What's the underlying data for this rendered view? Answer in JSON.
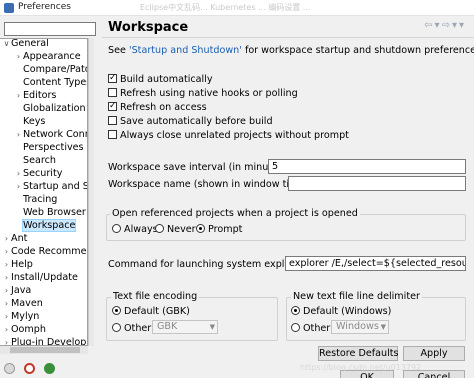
{
  "window": {
    "title": "Preferences",
    "ghost_text": "Eclipse中文乱码... Kubernetes ... 编码设置 ..."
  },
  "tree": {
    "items": [
      {
        "label": "General",
        "expanded": true
      },
      {
        "label": "Appearance"
      },
      {
        "label": "Compare/Pato"
      },
      {
        "label": "Content Types"
      },
      {
        "label": "Editors"
      },
      {
        "label": "Globalization"
      },
      {
        "label": "Keys"
      },
      {
        "label": "Network Conn"
      },
      {
        "label": "Perspectives"
      },
      {
        "label": "Search"
      },
      {
        "label": "Security"
      },
      {
        "label": "Startup and Sh"
      },
      {
        "label": "Tracing"
      },
      {
        "label": "Web Browser"
      },
      {
        "label": "Workspace",
        "selected": true
      },
      {
        "label": "Ant"
      },
      {
        "label": "Code Recommen"
      },
      {
        "label": "Help"
      },
      {
        "label": "Install/Update"
      },
      {
        "label": "Java"
      },
      {
        "label": "Maven"
      },
      {
        "label": "Mylyn"
      },
      {
        "label": "Oomph"
      },
      {
        "label": "Plug-in Develop"
      }
    ]
  },
  "page": {
    "title": "Workspace",
    "see_prefix": "See ",
    "see_link": "'Startup and Shutdown'",
    "see_suffix": " for workspace startup and shutdown preferences.",
    "checkboxes": [
      {
        "label": "Build automatically",
        "checked": true
      },
      {
        "label": "Refresh using native hooks or polling",
        "checked": false
      },
      {
        "label": "Refresh on access",
        "checked": true
      },
      {
        "label": "Save automatically before build",
        "checked": false
      },
      {
        "label": "Always close unrelated projects without prompt",
        "checked": false
      }
    ],
    "save_interval_label": "Workspace save interval (in minutes):",
    "save_interval_value": "5",
    "workspace_name_label": "Workspace name (shown in window title):",
    "workspace_name_value": "",
    "open_projects": {
      "title": "Open referenced projects when a project is opened",
      "options": [
        "Always",
        "Never",
        "Prompt"
      ],
      "selected": "Prompt"
    },
    "explorer_cmd_label": "Command for launching system explorer:",
    "explorer_cmd_value": "explorer /E,/select=${selected_resource_loc}",
    "text_encoding": {
      "title": "Text file encoding",
      "default_label": "Default (GBK)",
      "other_label": "Other:",
      "other_value": "GBK",
      "selected": "default"
    },
    "line_delimiter": {
      "title": "New text file line delimiter",
      "default_label": "Default (Windows)",
      "other_label": "Other:",
      "other_value": "Windows",
      "selected": "default"
    },
    "buttons": {
      "restore": "Restore Defaults",
      "apply": "Apply",
      "ok": "OK",
      "cancel": "Cancel"
    }
  },
  "watermark": "https://blog.csdn.net/u013792"
}
